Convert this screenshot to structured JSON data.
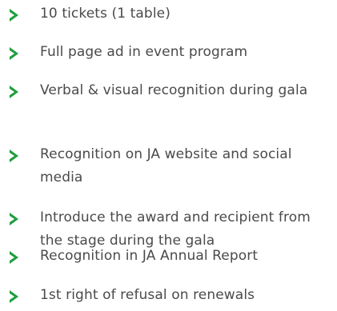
{
  "theme": {
    "accent": "#1f9e3e",
    "text": "#4a4a4a"
  },
  "benefits": {
    "icon": "chevron-right-icon",
    "items": [
      {
        "label": "10 tickets (1 table)"
      },
      {
        "label": "Full page ad in event program"
      },
      {
        "label": "Verbal & visual recognition during gala"
      },
      {
        "label": "Recognition on JA website and social media"
      },
      {
        "label": "Introduce the award and recipient from the stage during the gala"
      },
      {
        "label": "Recognition in JA Annual Report"
      },
      {
        "label": "1st right of refusal on renewals"
      }
    ]
  }
}
